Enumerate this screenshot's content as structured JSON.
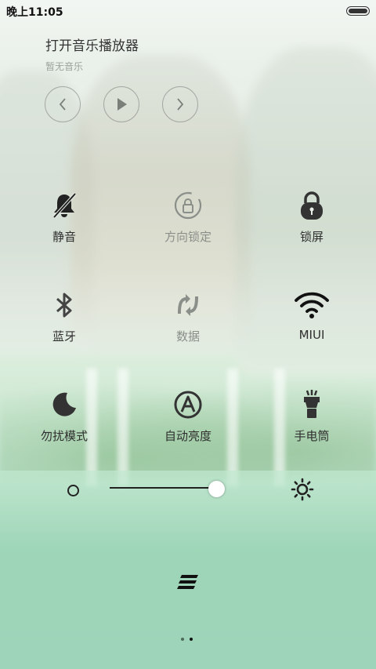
{
  "status_bar": {
    "time": "晚上11:05"
  },
  "music": {
    "title": "打开音乐播放器",
    "subtitle": "暂无音乐",
    "controls": [
      "previous-icon",
      "play-icon",
      "next-icon"
    ]
  },
  "toggles": [
    {
      "label": "静音",
      "icon": "bell-off-icon",
      "state": "on"
    },
    {
      "label": "方向锁定",
      "icon": "rotation-lock-icon",
      "state": "off"
    },
    {
      "label": "锁屏",
      "icon": "lock-icon",
      "state": "on"
    },
    {
      "label": "蓝牙",
      "icon": "bluetooth-icon",
      "state": "on"
    },
    {
      "label": "数据",
      "icon": "mobile-data-icon",
      "state": "off"
    },
    {
      "label": "MIUI",
      "icon": "wifi-icon",
      "state": "on"
    },
    {
      "label": "勿扰模式",
      "icon": "moon-icon",
      "state": "on"
    },
    {
      "label": "自动亮度",
      "icon": "auto-brightness-icon",
      "state": "on"
    },
    {
      "label": "手电筒",
      "icon": "flashlight-icon",
      "state": "on"
    }
  ],
  "brightness": {
    "level_fraction": 0.93
  },
  "pager": {
    "pages": 2,
    "current": 2
  },
  "colors": {
    "active": "#222222",
    "inactive": "#8a8f8a"
  }
}
